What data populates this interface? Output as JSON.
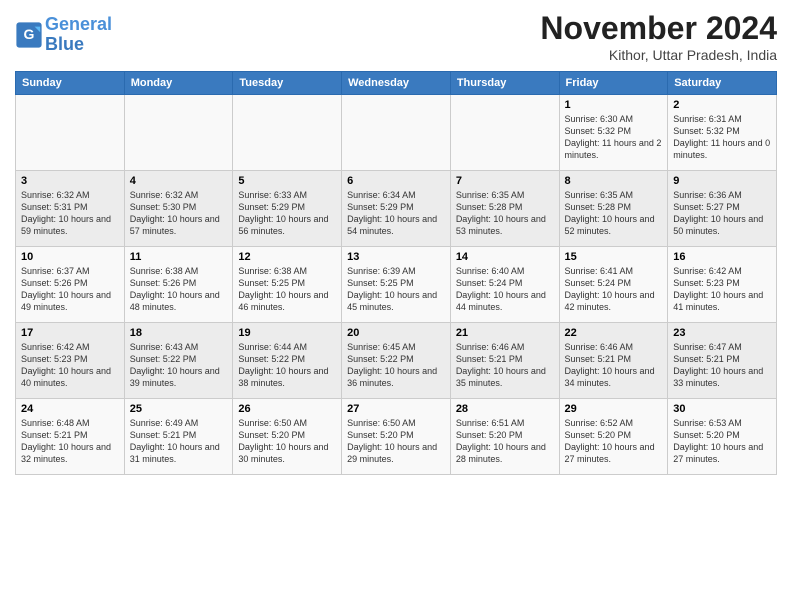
{
  "logo": {
    "line1": "General",
    "line2": "Blue"
  },
  "title": "November 2024",
  "location": "Kithor, Uttar Pradesh, India",
  "weekdays": [
    "Sunday",
    "Monday",
    "Tuesday",
    "Wednesday",
    "Thursday",
    "Friday",
    "Saturday"
  ],
  "weeks": [
    [
      {
        "day": "",
        "info": ""
      },
      {
        "day": "",
        "info": ""
      },
      {
        "day": "",
        "info": ""
      },
      {
        "day": "",
        "info": ""
      },
      {
        "day": "",
        "info": ""
      },
      {
        "day": "1",
        "info": "Sunrise: 6:30 AM\nSunset: 5:32 PM\nDaylight: 11 hours and 2 minutes."
      },
      {
        "day": "2",
        "info": "Sunrise: 6:31 AM\nSunset: 5:32 PM\nDaylight: 11 hours and 0 minutes."
      }
    ],
    [
      {
        "day": "3",
        "info": "Sunrise: 6:32 AM\nSunset: 5:31 PM\nDaylight: 10 hours and 59 minutes."
      },
      {
        "day": "4",
        "info": "Sunrise: 6:32 AM\nSunset: 5:30 PM\nDaylight: 10 hours and 57 minutes."
      },
      {
        "day": "5",
        "info": "Sunrise: 6:33 AM\nSunset: 5:29 PM\nDaylight: 10 hours and 56 minutes."
      },
      {
        "day": "6",
        "info": "Sunrise: 6:34 AM\nSunset: 5:29 PM\nDaylight: 10 hours and 54 minutes."
      },
      {
        "day": "7",
        "info": "Sunrise: 6:35 AM\nSunset: 5:28 PM\nDaylight: 10 hours and 53 minutes."
      },
      {
        "day": "8",
        "info": "Sunrise: 6:35 AM\nSunset: 5:28 PM\nDaylight: 10 hours and 52 minutes."
      },
      {
        "day": "9",
        "info": "Sunrise: 6:36 AM\nSunset: 5:27 PM\nDaylight: 10 hours and 50 minutes."
      }
    ],
    [
      {
        "day": "10",
        "info": "Sunrise: 6:37 AM\nSunset: 5:26 PM\nDaylight: 10 hours and 49 minutes."
      },
      {
        "day": "11",
        "info": "Sunrise: 6:38 AM\nSunset: 5:26 PM\nDaylight: 10 hours and 48 minutes."
      },
      {
        "day": "12",
        "info": "Sunrise: 6:38 AM\nSunset: 5:25 PM\nDaylight: 10 hours and 46 minutes."
      },
      {
        "day": "13",
        "info": "Sunrise: 6:39 AM\nSunset: 5:25 PM\nDaylight: 10 hours and 45 minutes."
      },
      {
        "day": "14",
        "info": "Sunrise: 6:40 AM\nSunset: 5:24 PM\nDaylight: 10 hours and 44 minutes."
      },
      {
        "day": "15",
        "info": "Sunrise: 6:41 AM\nSunset: 5:24 PM\nDaylight: 10 hours and 42 minutes."
      },
      {
        "day": "16",
        "info": "Sunrise: 6:42 AM\nSunset: 5:23 PM\nDaylight: 10 hours and 41 minutes."
      }
    ],
    [
      {
        "day": "17",
        "info": "Sunrise: 6:42 AM\nSunset: 5:23 PM\nDaylight: 10 hours and 40 minutes."
      },
      {
        "day": "18",
        "info": "Sunrise: 6:43 AM\nSunset: 5:22 PM\nDaylight: 10 hours and 39 minutes."
      },
      {
        "day": "19",
        "info": "Sunrise: 6:44 AM\nSunset: 5:22 PM\nDaylight: 10 hours and 38 minutes."
      },
      {
        "day": "20",
        "info": "Sunrise: 6:45 AM\nSunset: 5:22 PM\nDaylight: 10 hours and 36 minutes."
      },
      {
        "day": "21",
        "info": "Sunrise: 6:46 AM\nSunset: 5:21 PM\nDaylight: 10 hours and 35 minutes."
      },
      {
        "day": "22",
        "info": "Sunrise: 6:46 AM\nSunset: 5:21 PM\nDaylight: 10 hours and 34 minutes."
      },
      {
        "day": "23",
        "info": "Sunrise: 6:47 AM\nSunset: 5:21 PM\nDaylight: 10 hours and 33 minutes."
      }
    ],
    [
      {
        "day": "24",
        "info": "Sunrise: 6:48 AM\nSunset: 5:21 PM\nDaylight: 10 hours and 32 minutes."
      },
      {
        "day": "25",
        "info": "Sunrise: 6:49 AM\nSunset: 5:21 PM\nDaylight: 10 hours and 31 minutes."
      },
      {
        "day": "26",
        "info": "Sunrise: 6:50 AM\nSunset: 5:20 PM\nDaylight: 10 hours and 30 minutes."
      },
      {
        "day": "27",
        "info": "Sunrise: 6:50 AM\nSunset: 5:20 PM\nDaylight: 10 hours and 29 minutes."
      },
      {
        "day": "28",
        "info": "Sunrise: 6:51 AM\nSunset: 5:20 PM\nDaylight: 10 hours and 28 minutes."
      },
      {
        "day": "29",
        "info": "Sunrise: 6:52 AM\nSunset: 5:20 PM\nDaylight: 10 hours and 27 minutes."
      },
      {
        "day": "30",
        "info": "Sunrise: 6:53 AM\nSunset: 5:20 PM\nDaylight: 10 hours and 27 minutes."
      }
    ]
  ]
}
